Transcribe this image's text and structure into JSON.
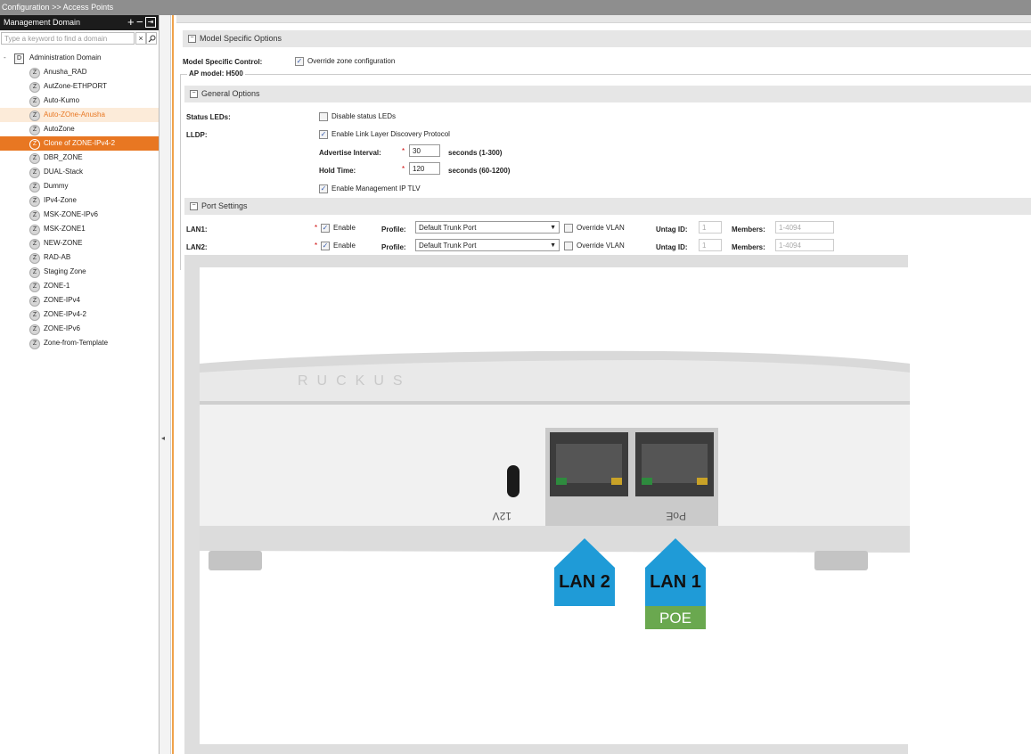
{
  "breadcrumb": {
    "section": "Configuration",
    "separator": ">>",
    "page": "Access Points"
  },
  "left_panel": {
    "title": "Management Domain",
    "search_placeholder": "Type a keyword to find a domain",
    "clear_label": "×",
    "root": {
      "badge": "D",
      "label": "Administration Domain",
      "expander": "-"
    },
    "zones": [
      {
        "label": "Anusha_RAD",
        "state": "normal"
      },
      {
        "label": "AutZone-ETHPORT",
        "state": "normal"
      },
      {
        "label": "Auto-Kumo",
        "state": "normal"
      },
      {
        "label": "Auto-ZOne-Anusha",
        "state": "hover"
      },
      {
        "label": "AutoZone",
        "state": "normal"
      },
      {
        "label": "Clone of ZONE-IPv4-2",
        "state": "selected"
      },
      {
        "label": "DBR_ZONE",
        "state": "normal"
      },
      {
        "label": "DUAL-Stack",
        "state": "normal"
      },
      {
        "label": "Dummy",
        "state": "normal"
      },
      {
        "label": "IPv4-Zone",
        "state": "normal"
      },
      {
        "label": "MSK-ZONE-IPv6",
        "state": "normal"
      },
      {
        "label": "MSK-ZONE1",
        "state": "normal"
      },
      {
        "label": "NEW-ZONE",
        "state": "normal"
      },
      {
        "label": "RAD-AB",
        "state": "normal"
      },
      {
        "label": "Staging Zone",
        "state": "normal"
      },
      {
        "label": "ZONE-1",
        "state": "normal"
      },
      {
        "label": "ZONE-IPv4",
        "state": "normal"
      },
      {
        "label": "ZONE-IPv4-2",
        "state": "normal"
      },
      {
        "label": "ZONE-IPv6",
        "state": "normal"
      },
      {
        "label": "Zone-from-Template",
        "state": "normal"
      }
    ],
    "zone_badge": "Z"
  },
  "model_specific": {
    "section_title": "Model Specific Options",
    "control_label": "Model Specific Control:",
    "override_label": "Override zone configuration",
    "override_checked": true,
    "ap_model_legend": "AP model: H500"
  },
  "general": {
    "section_title": "General Options",
    "status_leds_label": "Status LEDs:",
    "disable_leds_label": "Disable status LEDs",
    "disable_leds_checked": false,
    "lldp_label": "LLDP:",
    "enable_lldp_label": "Enable Link Layer Discovery Protocol",
    "enable_lldp_checked": true,
    "advertise_label": "Advertise Interval:",
    "advertise_value": "30",
    "advertise_hint": "seconds (1-300)",
    "hold_label": "Hold Time:",
    "hold_value": "120",
    "hold_hint": "seconds (60-1200)",
    "mgmt_tlv_label": "Enable Management IP TLV",
    "mgmt_tlv_checked": true,
    "required_mark": "*"
  },
  "ports": {
    "section_title": "Port Settings",
    "rows": [
      {
        "name": "LAN1:",
        "enable_label": "Enable",
        "enabled": true,
        "profile_label": "Profile:",
        "profile": "Default Trunk Port",
        "override_vlan_label": "Override VLAN",
        "untag_label": "Untag ID:",
        "untag_value": "1",
        "members_label": "Members:",
        "members_value": "1-4094"
      },
      {
        "name": "LAN2:",
        "enable_label": "Enable",
        "enabled": true,
        "profile_label": "Profile:",
        "profile": "Default Trunk Port",
        "override_vlan_label": "Override VLAN",
        "untag_label": "Untag ID:",
        "untag_value": "1",
        "members_label": "Members:",
        "members_value": "1-4094"
      }
    ]
  },
  "device_image": {
    "port_labels": [
      "LAN 2",
      "LAN 1"
    ],
    "poe_label": "POE",
    "silk_12v": "12V",
    "silk_poe": "PoE",
    "colors": {
      "arrow": "#1f9bd7",
      "poe": "#6aa84f"
    }
  }
}
